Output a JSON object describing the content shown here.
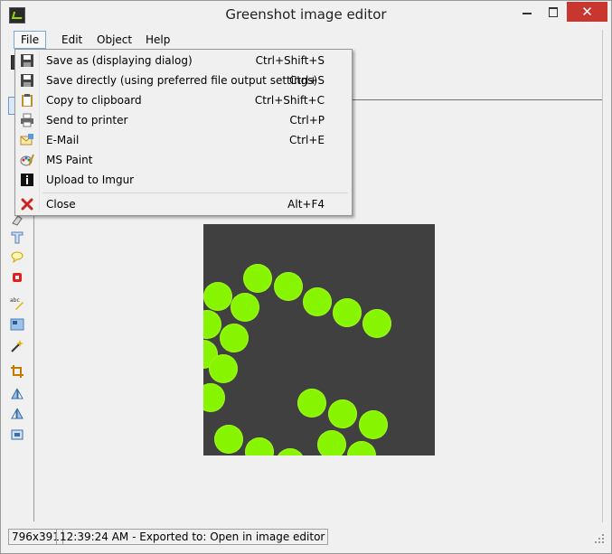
{
  "window": {
    "title": "Greenshot image editor"
  },
  "menubar": {
    "file": "File",
    "edit": "Edit",
    "object": "Object",
    "help": "Help"
  },
  "file_menu": {
    "items": [
      {
        "label": "Save as (displaying dialog)",
        "shortcut": "Ctrl+Shift+S",
        "icon": "save-icon"
      },
      {
        "label": "Save directly (using preferred file output settings)",
        "shortcut": "Ctrl+S",
        "icon": "save-direct-icon"
      },
      {
        "label": "Copy to clipboard",
        "shortcut": "Ctrl+Shift+C",
        "icon": "clipboard-icon"
      },
      {
        "label": "Send to printer",
        "shortcut": "Ctrl+P",
        "icon": "printer-icon"
      },
      {
        "label": "E-Mail",
        "shortcut": "Ctrl+E",
        "icon": "email-icon"
      },
      {
        "label": "MS Paint",
        "shortcut": "",
        "icon": "paint-icon"
      },
      {
        "label": "Upload to Imgur",
        "shortcut": "",
        "icon": "imgur-icon"
      },
      {
        "label": "Close",
        "shortcut": "Alt+F4",
        "icon": "close-icon"
      }
    ]
  },
  "statusbar": {
    "size": "796x391",
    "message": "12:39:24 AM - Exported to: Open in image editor"
  },
  "colors": {
    "canvas_bg": "#404040",
    "dot": "#88f500",
    "close_button": "#c7372f",
    "menu_highlight": "#7aa7d6"
  }
}
